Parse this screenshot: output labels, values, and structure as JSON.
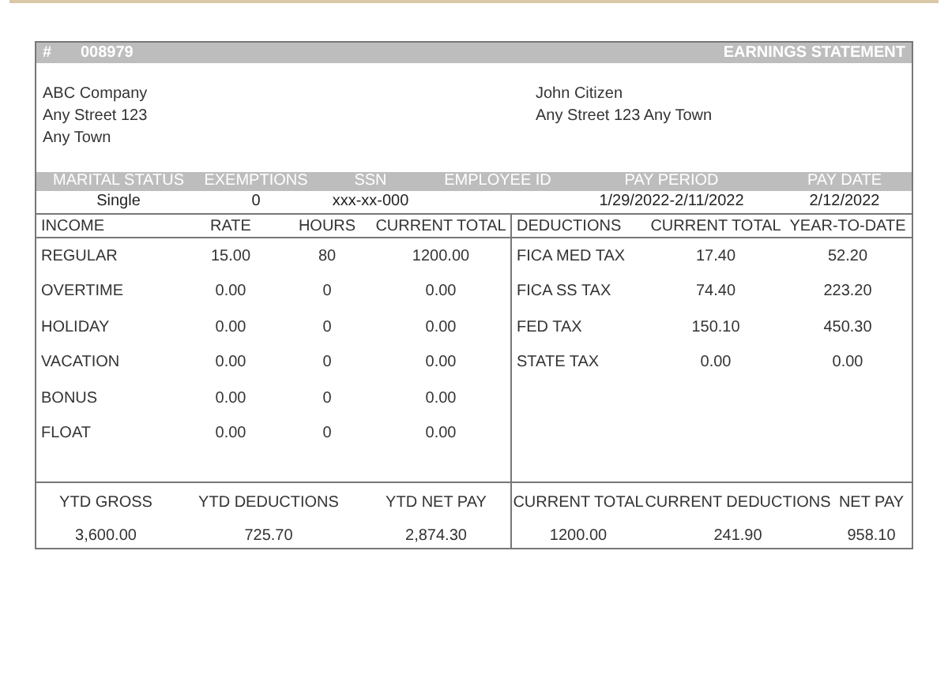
{
  "header": {
    "number_mark": "#",
    "number": "008979",
    "title": "EARNINGS STATEMENT"
  },
  "employer": [
    "ABC Company",
    "Any Street 123",
    "Any Town"
  ],
  "employee": [
    "John Citizen",
    "Any Street 123 Any Town"
  ],
  "info": {
    "columns": [
      {
        "label": "MARITAL STATUS",
        "value": "Single"
      },
      {
        "label": "EXEMPTIONS",
        "value": "0"
      },
      {
        "label": "SSN",
        "value": "xxx-xx-000"
      },
      {
        "label": "EMPLOYEE ID"
      },
      {
        "label": "PAY PERIOD",
        "value": "1/29/2022-2/11/2022"
      },
      {
        "label": "PAY DATE",
        "value": "2/12/2022"
      }
    ]
  },
  "income": {
    "columns": [
      "INCOME",
      "RATE",
      "HOURS",
      "CURRENT TOTAL"
    ],
    "rows": [
      [
        "REGULAR",
        "15.00",
        "80",
        "1200.00"
      ],
      [
        "OVERTIME",
        "0.00",
        "0",
        "0.00"
      ],
      [
        "HOLIDAY",
        "0.00",
        "0",
        "0.00"
      ],
      [
        "VACATION",
        "0.00",
        "0",
        "0.00"
      ],
      [
        "BONUS",
        "0.00",
        "0",
        "0.00"
      ],
      [
        "FLOAT",
        "0.00",
        "0",
        "0.00"
      ]
    ]
  },
  "deductions": {
    "columns": [
      "DEDUCTIONS",
      "CURRENT TOTAL",
      "YEAR-TO-DATE"
    ],
    "rows": [
      [
        "FICA MED TAX",
        "17.40",
        "52.20"
      ],
      [
        "FICA SS TAX",
        "74.40",
        "223.20"
      ],
      [
        "FED TAX",
        "150.10",
        "450.30"
      ],
      [
        "STATE TAX",
        "0.00",
        "0.00"
      ]
    ]
  },
  "ytd": {
    "columns": [
      "YTD GROSS",
      "YTD DEDUCTIONS",
      "YTD NET PAY"
    ],
    "values": [
      "3,600.00",
      "725.70",
      "2,874.30"
    ]
  },
  "current": {
    "columns": [
      "CURRENT TOTAL",
      "CURRENT DEDUCTIONS",
      "NET PAY"
    ],
    "values": [
      "1200.00",
      "241.90",
      "958.10"
    ]
  }
}
